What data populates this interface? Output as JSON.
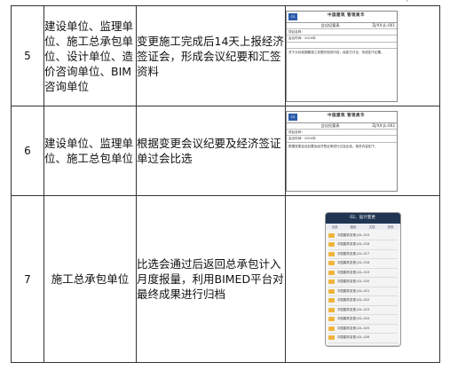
{
  "rows": [
    {
      "number": "5",
      "unit": "建设单位、监理单位、施工总承包单位、设计单位、造价咨询单位、BIM咨询单位",
      "description": "变更施工完成后14天上报经济签证会，形成会议纪要和汇签资料",
      "thumb": {
        "brand": "中国建筑",
        "motto": "管理奥华",
        "title": "会议纪要表",
        "code": "ZJ/XX-JL-001",
        "line1": "项目名称：",
        "line2": "会议时间：2024年",
        "body": "关于大标准图集施工变更的相关内容，经各方讨论，形成如下纪要。"
      }
    },
    {
      "number": "6",
      "unit": "建设单位、监理单位、施工总包单位",
      "description": "根据变更会议纪要及经济签证单过会比选",
      "thumb": {
        "brand": "中国建筑",
        "motto": "管理奥华",
        "title": "会议纪要表",
        "code": "ZJ/XX-JL-002",
        "line1": "项目名称：",
        "line2": "会议时间：2024年",
        "body": "根据变更会议纪要及经济签证单进行过会比选，相关内容如下。"
      }
    },
    {
      "number": "7",
      "unit": "施工总承包单位",
      "description": "比选会通过后返回总承包计入月度报量，利用BIMED平台对最终成果进行归档",
      "phone": {
        "title": "02、设计变更",
        "tabs": [
          "全部",
          "图纸",
          "文档",
          "其他"
        ],
        "items": [
          "中国建筑变更-JGL-015",
          "中国建筑变更-JGL-016",
          "中国建筑变更-JGL-017",
          "中国建筑变更-JGL-018",
          "中国建筑变更-JGL-019",
          "中国建筑变更-JGL-020",
          "中国建筑变更-JGL-021",
          "中国建筑变更-JGL-022",
          "中国建筑变更-JGL-023",
          "中国建筑变更-JGL-024",
          "中国建筑变更-JGL-025",
          "中国建筑变更-JGL-026"
        ]
      }
    }
  ]
}
